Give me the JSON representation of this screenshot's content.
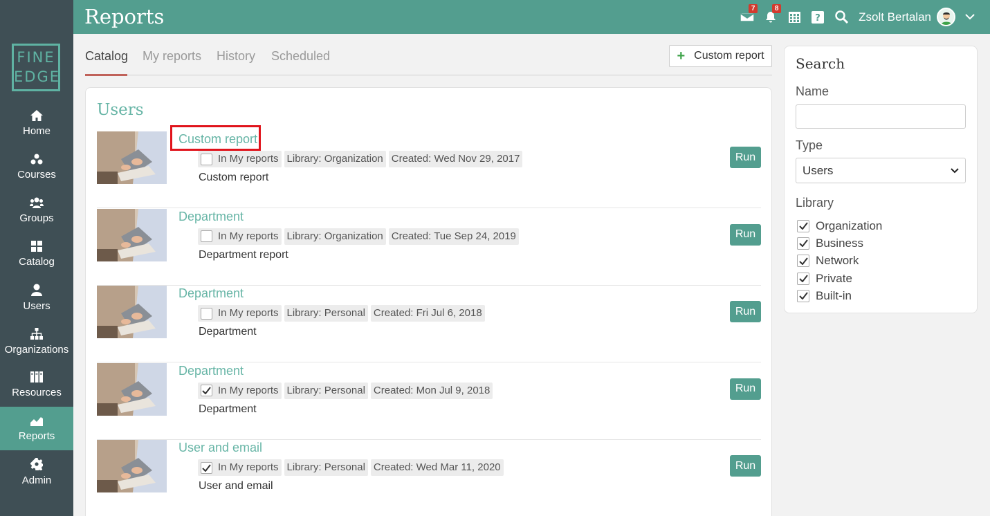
{
  "header": {
    "title": "Reports",
    "messages_badge": "7",
    "notifications_badge": "8",
    "user_name": "Zsolt Bertalan"
  },
  "logo": {
    "line1": "FINE",
    "line2": "EDGE"
  },
  "sidebar": {
    "items": [
      {
        "label": "Home",
        "icon": "home-icon"
      },
      {
        "label": "Courses",
        "icon": "courses-icon"
      },
      {
        "label": "Groups",
        "icon": "groups-icon"
      },
      {
        "label": "Catalog",
        "icon": "catalog-icon"
      },
      {
        "label": "Users",
        "icon": "user-icon"
      },
      {
        "label": "Organizations",
        "icon": "org-chart-icon"
      },
      {
        "label": "Resources",
        "icon": "books-icon"
      },
      {
        "label": "Reports",
        "icon": "chart-icon",
        "active": true
      },
      {
        "label": "Admin",
        "icon": "gear-icon"
      }
    ]
  },
  "tabs": [
    "Catalog",
    "My reports",
    "History",
    "Scheduled"
  ],
  "custom_report_button": "Custom report",
  "section_title": "Users",
  "in_my_reports_label": "In My reports",
  "run_label": "Run",
  "reports": [
    {
      "title": "Custom report",
      "checked": false,
      "library": "Library: Organization",
      "created": "Created: Wed Nov 29, 2017",
      "description": "Custom report",
      "highlighted": true
    },
    {
      "title": "Department",
      "checked": false,
      "library": "Library: Organization",
      "created": "Created: Tue Sep 24, 2019",
      "description": "Department report"
    },
    {
      "title": "Department",
      "checked": false,
      "library": "Library: Personal",
      "created": "Created: Fri Jul 6, 2018",
      "description": "Department"
    },
    {
      "title": "Department",
      "checked": true,
      "library": "Library: Personal",
      "created": "Created: Mon Jul 9, 2018",
      "description": "Department"
    },
    {
      "title": "User and email",
      "checked": true,
      "library": "Library: Personal",
      "created": "Created: Wed Mar 11, 2020",
      "description": "User and email"
    }
  ],
  "search": {
    "title": "Search",
    "name_label": "Name",
    "name_value": "",
    "type_label": "Type",
    "type_value": "Users",
    "library_label": "Library",
    "library_options": [
      {
        "label": "Organization",
        "checked": true
      },
      {
        "label": "Business",
        "checked": true
      },
      {
        "label": "Network",
        "checked": true
      },
      {
        "label": "Private",
        "checked": true
      },
      {
        "label": "Built-in",
        "checked": true
      }
    ]
  },
  "colors": {
    "accent": "#539e8f",
    "sidebar": "#3f4f55",
    "link": "#67b5a6",
    "highlight": "#e0131b",
    "badge": "#d23b2f"
  }
}
